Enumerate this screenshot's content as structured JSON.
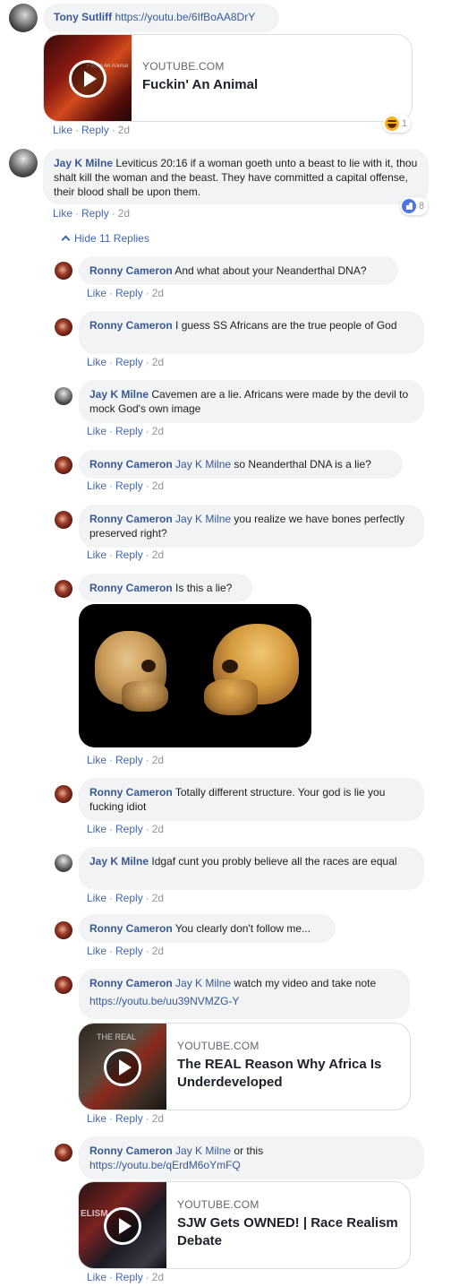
{
  "comments": [
    {
      "author": "Tony Sutliff",
      "text": "https://youtu.be/6IfBoAA8DrY",
      "meta": {
        "like": "Like",
        "reply": "Reply",
        "time": "2d"
      },
      "reaction_count": "1",
      "card": {
        "domain": "YOUTUBE.COM",
        "title": "Fuckin' An Animal",
        "thumb_text": "Fuckin An Animal"
      }
    },
    {
      "author": "Jay K Milne",
      "text": "Leviticus 20:16 if a woman goeth unto a beast to lie with it, thou shalt kill the woman and the beast. They have committed a capital offense, their blood shall be upon them.",
      "meta": {
        "like": "Like",
        "reply": "Reply",
        "time": "2d"
      },
      "reaction_count": "8"
    }
  ],
  "hide_replies": "Hide 11 Replies",
  "replies": [
    {
      "author": "Ronny Cameron",
      "tag": "",
      "text": "And what about your Neanderthal DNA?",
      "meta": {
        "like": "Like",
        "reply": "Reply",
        "time": "2d"
      }
    },
    {
      "author": "Ronny Cameron",
      "tag": "",
      "text": "I guess SS Africans are the true people of God",
      "meta": {
        "like": "Like",
        "reply": "Reply",
        "time": "2d"
      }
    },
    {
      "author": "Jay K Milne",
      "tag": "",
      "text": "Cavemen are a lie. Africans were made by the devil to mock God's own image",
      "meta": {
        "like": "Like",
        "reply": "Reply",
        "time": "2d"
      }
    },
    {
      "author": "Ronny Cameron",
      "tag": "Jay K Milne",
      "text": "so Neanderthal DNA is a lie?",
      "meta": {
        "like": "Like",
        "reply": "Reply",
        "time": "2d"
      }
    },
    {
      "author": "Ronny Cameron",
      "tag": "Jay K Milne",
      "text": "you realize we have bones perfectly preserved right?",
      "meta": {
        "like": "Like",
        "reply": "Reply",
        "time": "2d"
      }
    },
    {
      "author": "Ronny Cameron",
      "tag": "",
      "text": "Is this a lie?",
      "meta": {
        "like": "Like",
        "reply": "Reply",
        "time": "2d"
      }
    },
    {
      "author": "Ronny Cameron",
      "tag": "",
      "text": "Totally different structure. Your god is lie you fucking idiot",
      "meta": {
        "like": "Like",
        "reply": "Reply",
        "time": "2d"
      }
    },
    {
      "author": "Jay K Milne",
      "tag": "",
      "text": "Idgaf cunt you probly believe all the races are equal",
      "meta": {
        "like": "Like",
        "reply": "Reply",
        "time": "2d"
      }
    },
    {
      "author": "Ronny Cameron",
      "tag": "",
      "text": "You clearly don't follow me...",
      "meta": {
        "like": "Like",
        "reply": "Reply",
        "time": "2d"
      }
    },
    {
      "author": "Ronny Cameron",
      "tag": "Jay K Milne",
      "text": "watch my video and take note",
      "link": "https://youtu.be/uu39NVMZG-Y",
      "meta": {
        "like": "Like",
        "reply": "Reply",
        "time": "2d"
      },
      "card": {
        "domain": "YOUTUBE.COM",
        "title": "The REAL Reason Why Africa Is Underdeveloped",
        "thumb_text": "THE REAL"
      }
    },
    {
      "author": "Ronny Cameron",
      "tag": "Jay K Milne",
      "text": "or this",
      "link": "https://youtu.be/qErdM6oYmFQ",
      "meta": {
        "like": "Like",
        "reply": "Reply",
        "time": "2d"
      },
      "card": {
        "domain": "YOUTUBE.COM",
        "title": "SJW Gets OWNED! | Race Realism Debate",
        "thumb_text": "ELISM"
      }
    }
  ],
  "icons": {
    "play": "play-icon",
    "haha": "haha-reaction-icon",
    "like": "like-reaction-icon",
    "chevron": "chevron-up-icon"
  },
  "colors": {
    "name": "#385898",
    "action": "#4267b2",
    "bubble": "#f2f3f5",
    "meta": "#90949c"
  }
}
